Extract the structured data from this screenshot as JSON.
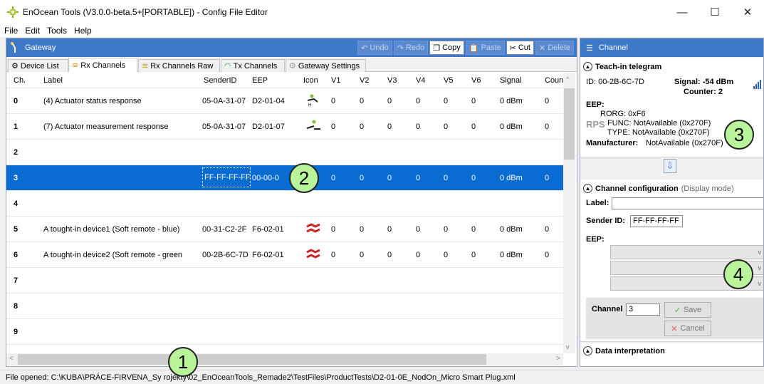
{
  "window": {
    "title": "EnOcean Tools (V3.0.0-beta.5+[PORTABLE]) - Config File Editor",
    "minimize": "—",
    "maximize": "☐",
    "close": "✕"
  },
  "menu": {
    "file": "File",
    "edit": "Edit",
    "tools": "Tools",
    "help": "Help"
  },
  "gateway": {
    "title": "Gateway",
    "toolbar": {
      "undo": "Undo",
      "redo": "Redo",
      "copy": "Copy",
      "paste": "Paste",
      "cut": "Cut",
      "delete": "Delete"
    },
    "tabs": [
      "Device List",
      "Rx Channels",
      "Rx Channels Raw",
      "Tx Channels",
      "Gateway Settings"
    ]
  },
  "grid": {
    "columns": [
      "Ch.",
      "Label",
      "SenderID",
      "EEP",
      "Icon",
      "V1",
      "V2",
      "V3",
      "V4",
      "V5",
      "V6",
      "Signal",
      "Coun"
    ],
    "rows": [
      {
        "ch": "0",
        "label": "(4) Actuator status response",
        "sender": "05-0A-31-07",
        "eep": "D2-01-04",
        "icon": "actuator-h-icon",
        "v": [
          "0",
          "0",
          "0",
          "0",
          "0",
          "0"
        ],
        "signal": "0 dBm",
        "count": "0"
      },
      {
        "ch": "1",
        "label": "(7) Actuator measurement response",
        "sender": "05-0A-31-07",
        "eep": "D2-01-07",
        "icon": "actuator-meter-icon",
        "v": [
          "0",
          "0",
          "0",
          "0",
          "0",
          "0"
        ],
        "signal": "0 dBm",
        "count": "0"
      },
      {
        "ch": "2",
        "label": "",
        "sender": "",
        "eep": "",
        "icon": "",
        "v": [
          "",
          "",
          "",
          "",
          "",
          ""
        ],
        "signal": "",
        "count": ""
      },
      {
        "ch": "3",
        "label": "",
        "sender": "FF-FF-FF-FF",
        "eep": "00-00-0",
        "icon": "",
        "v": [
          "0",
          "0",
          "0",
          "0",
          "0",
          "0"
        ],
        "signal": "0 dBm",
        "count": "0"
      },
      {
        "ch": "4",
        "label": "",
        "sender": "",
        "eep": "",
        "icon": "",
        "v": [
          "",
          "",
          "",
          "",
          "",
          ""
        ],
        "signal": "",
        "count": ""
      },
      {
        "ch": "5",
        "label": "A tought-in device1 (Soft remote - blue)",
        "sender": "00-31-C2-2F",
        "eep": "F6-02-01",
        "icon": "rocker-switch-icon",
        "v": [
          "0",
          "0",
          "0",
          "0",
          "0",
          "0"
        ],
        "signal": "0 dBm",
        "count": "0"
      },
      {
        "ch": "6",
        "label": "A tought-in device2 (Soft remote - green",
        "sender": "00-2B-6C-7D",
        "eep": "F6-02-01",
        "icon": "rocker-switch-icon",
        "v": [
          "0",
          "0",
          "0",
          "0",
          "0",
          "0"
        ],
        "signal": "0 dBm",
        "count": "0"
      },
      {
        "ch": "7",
        "label": "",
        "sender": "",
        "eep": "",
        "icon": "",
        "v": [
          "",
          "",
          "",
          "",
          "",
          ""
        ],
        "signal": "",
        "count": ""
      },
      {
        "ch": "8",
        "label": "",
        "sender": "",
        "eep": "",
        "icon": "",
        "v": [
          "",
          "",
          "",
          "",
          "",
          ""
        ],
        "signal": "",
        "count": ""
      },
      {
        "ch": "9",
        "label": "",
        "sender": "",
        "eep": "",
        "icon": "",
        "v": [
          "",
          "",
          "",
          "",
          "",
          ""
        ],
        "signal": "",
        "count": ""
      },
      {
        "ch": "10",
        "label": "",
        "sender": "",
        "eep": "",
        "icon": "",
        "v": [
          "",
          "",
          "",
          "",
          "",
          ""
        ],
        "signal": "",
        "count": ""
      }
    ],
    "selected_row": "3"
  },
  "status": {
    "text": "File opened: C:\\KUBA\\PRÁCE-FIRVENA_Sy        rojekty\\02_EnOceanTools_Remade2\\TestFiles\\ProductTests\\D2-01-0E_NodOn_Micro Smart Plug.xml"
  },
  "channel": {
    "title": "Channel",
    "teach_in": {
      "heading": "Teach-in telegram",
      "id": "ID: 00-2B-6C-7D",
      "signal": "Signal: -54 dBm",
      "counter": "Counter: 2",
      "eep_label": "EEP:",
      "rorg": "RORG: 0xF6",
      "rps": "RPS",
      "func": "FUNC: NotAvailable (0x270F)",
      "type": "TYPE: NotAvailable (0x270F)",
      "manufacturer_label": "Manufacturer:",
      "manufacturer": "NotAvailable (0x270F)"
    },
    "config": {
      "heading": "Channel configuration",
      "mode": "(Display mode)",
      "label_label": "Label:",
      "label_value": "",
      "sender_label": "Sender ID:",
      "sender_value": "FF-FF-FF-FF",
      "eep_label": "EEP:",
      "channel_label": "Channel",
      "channel_value": "3",
      "save": "Save",
      "cancel": "Cancel"
    },
    "data_interpretation": {
      "heading": "Data interpretation"
    }
  },
  "callouts": [
    "1",
    "2",
    "3",
    "4"
  ],
  "colors": {
    "header_blue": "#3f78c9",
    "selection_blue": "#0a6cd0",
    "callout_green": "#b9f39a"
  }
}
